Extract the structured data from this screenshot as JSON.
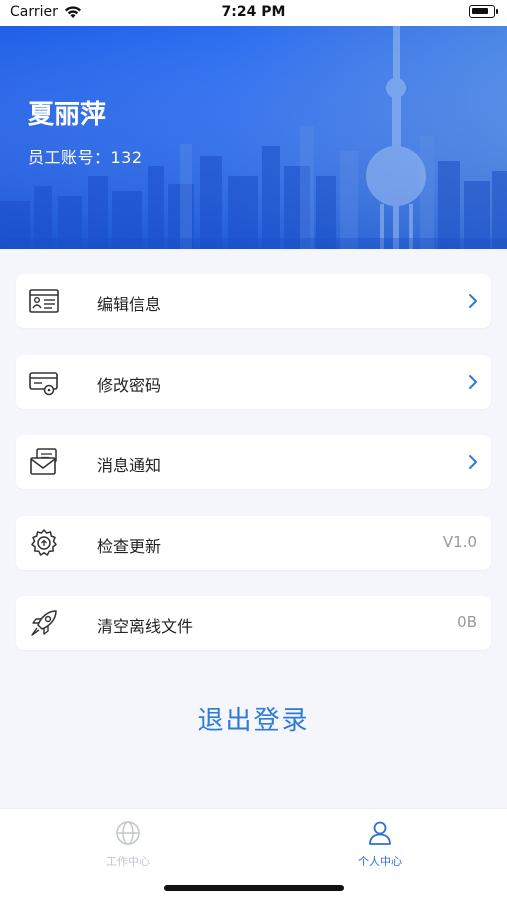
{
  "status_bar": {
    "carrier": "Carrier",
    "time": "7:24 PM"
  },
  "header": {
    "name": "夏丽萍",
    "employee_id": "员工账号：132"
  },
  "menu": [
    {
      "label": "编辑信息",
      "icon": "edit-info-icon",
      "trailing": "chevron"
    },
    {
      "label": "修改密码",
      "icon": "change-password-icon",
      "trailing": "chevron"
    },
    {
      "label": "消息通知",
      "icon": "message-notification-icon",
      "trailing": "chevron"
    },
    {
      "label": "检查更新",
      "icon": "check-update-icon",
      "trailing": "V1.0"
    },
    {
      "label": "清空离线文件",
      "icon": "rocket-icon",
      "trailing": "0B"
    }
  ],
  "logout_label": "退出登录",
  "tabs": [
    {
      "label": "工作中心",
      "icon": "globe-icon",
      "active": false
    },
    {
      "label": "个人中心",
      "icon": "person-icon",
      "active": true
    }
  ],
  "colors": {
    "banner": "#2a6cf0",
    "accent": "#2b7bd9",
    "inactive_tab": "#c2c6ce"
  }
}
